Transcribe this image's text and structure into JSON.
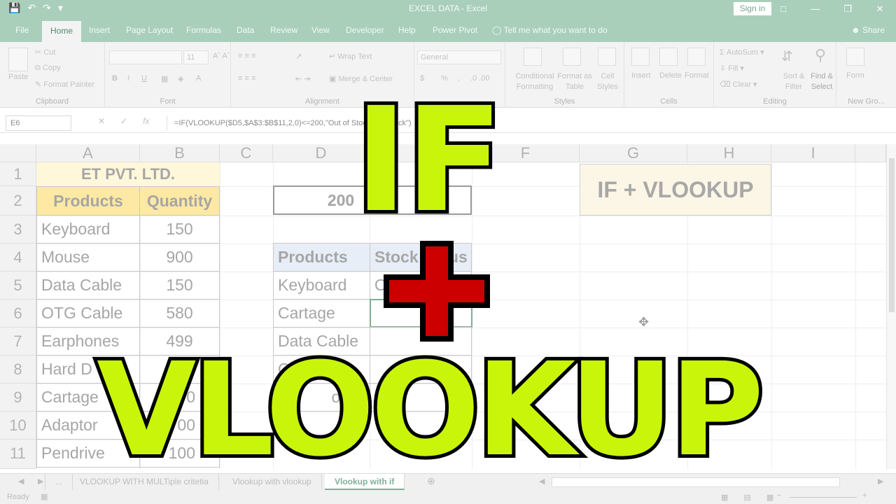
{
  "window": {
    "title": "EXCEL DATA  -  Excel",
    "sign_in": "Sign in",
    "min": "—",
    "max": "❐",
    "close": "✕"
  },
  "ribbon_tabs": [
    "File",
    "Home",
    "Insert",
    "Page Layout",
    "Formulas",
    "Data",
    "Review",
    "View",
    "Developer",
    "Help",
    "Power Pivot"
  ],
  "active_tab": "Home",
  "tell_me": "Tell me what you want to do",
  "share": "Share",
  "ribbon": {
    "clipboard": {
      "label": "Clipboard",
      "paste": "Paste",
      "cut": "Cut",
      "copy": "Copy",
      "format_painter": "Format Painter"
    },
    "font": {
      "label": "Font",
      "size": "11",
      "bold": "B",
      "italic": "I",
      "underline": "U"
    },
    "alignment": {
      "label": "Alignment",
      "wrap_text": "Wrap Text",
      "merge_center": "Merge & Center"
    },
    "number": {
      "format": "General",
      "currency": "$",
      "percent": "%"
    },
    "styles": {
      "label": "Styles",
      "conditional": "Conditional Formatting",
      "format_as_table": "Format as Table",
      "cell_styles": "Cell Styles"
    },
    "cells": {
      "label": "Cells",
      "insert": "Insert",
      "delete": "Delete",
      "format": "Format"
    },
    "editing": {
      "label": "Editing",
      "autosum": "AutoSum",
      "fill": "Fill",
      "clear": "Clear",
      "sort_filter": "Sort & Filter",
      "find_select": "Find & Select"
    },
    "new_group": {
      "label": "New Gro...",
      "form": "Form"
    }
  },
  "formula_bar": {
    "name_box": "E6",
    "cancel": "✕",
    "enter": "✓",
    "fx": "fx",
    "formula": "=IF(VLOOKUP($D5,$A$3:$B$11,2,0)<=200,\"Out of Stock\",\"In Stock\")"
  },
  "columns": [
    "A",
    "B",
    "C",
    "D",
    "E",
    "F",
    "G",
    "H",
    "I"
  ],
  "rows": [
    "1",
    "2",
    "3",
    "4",
    "5",
    "6",
    "7",
    "8",
    "9",
    "10",
    "11"
  ],
  "sheet": {
    "company": "ET PVT. LTD.",
    "headers": {
      "products": "Products",
      "quantity": "Quantity"
    },
    "items": [
      {
        "product": "Keyboard",
        "quantity": "150"
      },
      {
        "product": "Mouse",
        "quantity": "900"
      },
      {
        "product": "Data Cable",
        "quantity": "150"
      },
      {
        "product": "OTG Cable",
        "quantity": "580"
      },
      {
        "product": "Earphones",
        "quantity": "499"
      },
      {
        "product": "Hard D",
        "quantity": ""
      },
      {
        "product": "Cartage",
        "quantity": "0"
      },
      {
        "product": "Adaptor",
        "quantity": "00"
      },
      {
        "product": "Pendrive",
        "quantity": "100"
      }
    ],
    "criteria_value": "200",
    "lookup_headers": {
      "products": "Products",
      "stock": "Stock",
      "status_tail": "us"
    },
    "lookup_items": [
      "Keyboard",
      "Cartage",
      "Data Cable",
      "OT",
      "or"
    ],
    "lookup_e5": "O",
    "label_box": "IF + VLOOKUP"
  },
  "overlay": {
    "line1": "IF",
    "line2": "VLOOKUP",
    "colors": {
      "text_fill": "#c9f50b",
      "stroke": "#000000",
      "plus": "#cc0000"
    }
  },
  "sheet_tabs": {
    "ellipsis": "...",
    "tabs": [
      "VLOOKUP WITH MULTiple critetia",
      "Vlookup with vlookup",
      "Vlookup with if"
    ],
    "active": "Vlookup with if",
    "add": "⊕"
  },
  "status": {
    "ready": "Ready"
  }
}
